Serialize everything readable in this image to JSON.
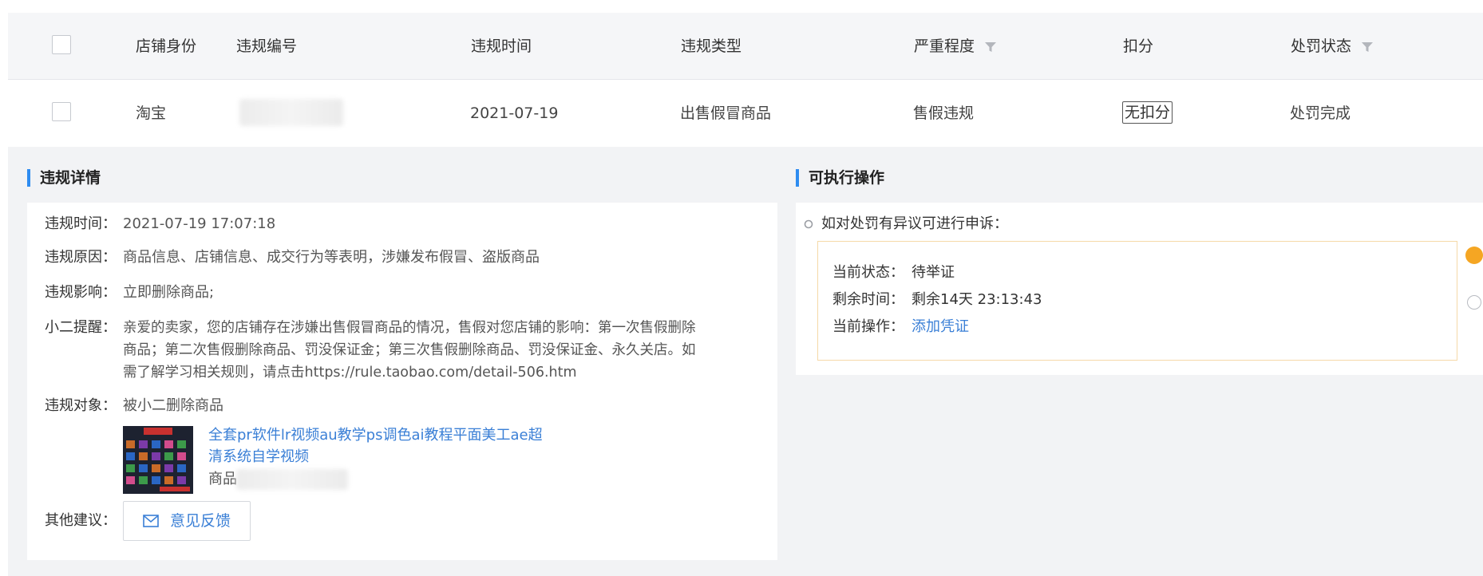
{
  "table": {
    "headers": {
      "shop_identity": "店铺身份",
      "violation_no": "违规编号",
      "violation_time": "违规时间",
      "violation_type": "违规类型",
      "severity": "严重程度",
      "deduction": "扣分",
      "penalty_status": "处罚状态"
    },
    "row": {
      "shop_identity": "淘宝",
      "violation_time": "2021-07-19",
      "violation_type": "出售假冒商品",
      "severity": "售假违规",
      "deduction": "无扣分",
      "penalty_status": "处罚完成"
    }
  },
  "details": {
    "title": "违规详情",
    "time_label": "违规时间：",
    "time_value": "2021-07-19 17:07:18",
    "reason_label": "违规原因：",
    "reason_value": "商品信息、店铺信息、成交行为等表明，涉嫌发布假冒、盗版商品",
    "impact_label": "违规影响：",
    "impact_value": "立即删除商品;",
    "reminder_label": "小二提醒：",
    "reminder_line1": "亲爱的卖家，您的店铺存在涉嫌出售假冒商品的情况，售假对您店铺的影响：第一次售假删除",
    "reminder_line2": "商品；第二次售假删除商品、罚没保证金；第三次售假删除商品、罚没保证金、永久关店。如",
    "reminder_line3": "需了解学习相关规则，请点击https://rule.taobao.com/detail-506.htm",
    "object_label": "违规对象：",
    "object_value": "被小二删除商品",
    "product_title_line1": "全套pr软件lr视频au教学ps调色ai教程平面美工ae超",
    "product_title_line2": "清系统自学视频",
    "product_id_label": "商品",
    "other_label": "其他建议：",
    "feedback_button": "意见反馈"
  },
  "actions": {
    "title": "可执行操作",
    "appeal_text": "如对处罚有异议可进行申诉：",
    "status_label": "当前状态：",
    "status_value": "待举证",
    "remaining_label": "剩余时间：",
    "remaining_value": "剩余14天 23:13:43",
    "operation_label": "当前操作：",
    "operation_link": "添加凭证"
  },
  "colors": {
    "accent": "#2e8cf0",
    "link": "#3a7fd6",
    "notice_border": "#f5d9a8",
    "step_orange": "#f5a623"
  }
}
